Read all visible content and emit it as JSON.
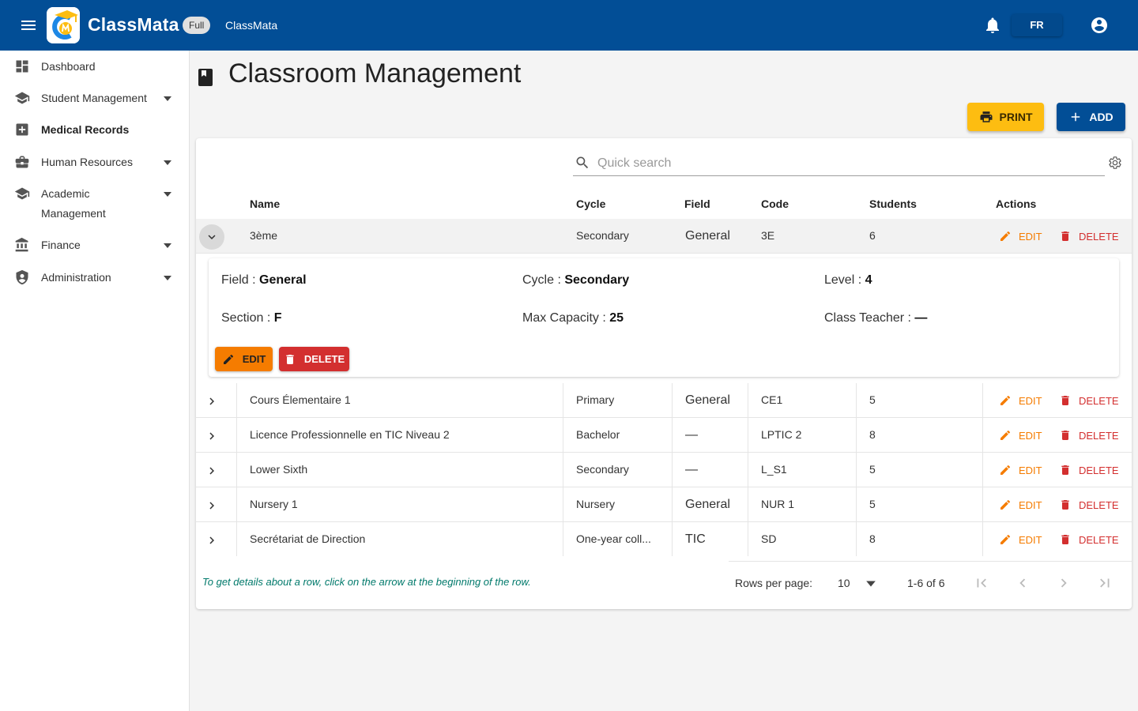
{
  "app": {
    "brand": "ClassMata",
    "plan_badge": "Full",
    "top_link": "ClassMata",
    "language": "FR"
  },
  "sidebar": {
    "items": [
      {
        "label": "Dashboard",
        "icon": "dashboard-icon",
        "has_caret": false,
        "bold": false
      },
      {
        "label": "Student Management",
        "icon": "school-icon",
        "has_caret": true,
        "bold": false
      },
      {
        "label": "Medical Records",
        "icon": "medical-icon",
        "has_caret": false,
        "bold": true
      },
      {
        "label": "Human Resources",
        "icon": "briefcase-icon",
        "has_caret": true,
        "bold": false
      },
      {
        "label": "Academic Management",
        "icon": "school-icon",
        "has_caret": true,
        "bold": false
      },
      {
        "label": "Finance",
        "icon": "bank-icon",
        "has_caret": true,
        "bold": false
      },
      {
        "label": "Administration",
        "icon": "admin-shield-icon",
        "has_caret": true,
        "bold": false
      }
    ]
  },
  "page": {
    "title": "Classroom Management",
    "print_label": "PRINT",
    "add_label": "ADD"
  },
  "search": {
    "placeholder": "Quick search",
    "value": ""
  },
  "table": {
    "columns": [
      "Name",
      "Cycle",
      "Field",
      "Code",
      "Students",
      "Actions"
    ],
    "edit_label": "EDIT",
    "delete_label": "DELETE",
    "rows": [
      {
        "name": "3ème",
        "cycle": "Secondary",
        "field": "General",
        "code": "3E",
        "students": "6",
        "expanded": true
      },
      {
        "name": "Cours Élementaire 1",
        "cycle": "Primary",
        "field": "General",
        "code": "CE1",
        "students": "5",
        "expanded": false
      },
      {
        "name": "Licence Professionnelle en TIC Niveau 2",
        "cycle": "Bachelor",
        "field": "—",
        "code": "LPTIC 2",
        "students": "8",
        "expanded": false
      },
      {
        "name": "Lower Sixth",
        "cycle": "Secondary",
        "field": "—",
        "code": "L_S1",
        "students": "5",
        "expanded": false
      },
      {
        "name": "Nursery 1",
        "cycle": "Nursery",
        "field": "General",
        "code": "NUR 1",
        "students": "5",
        "expanded": false
      },
      {
        "name": "Secrétariat de Direction",
        "cycle": "One-year coll...",
        "field": "TIC",
        "code": "SD",
        "students": "8",
        "expanded": false
      }
    ]
  },
  "detail": {
    "field_label": "Field : ",
    "field_value": "General",
    "cycle_label": "Cycle : ",
    "cycle_value": "Secondary",
    "level_label": "Level : ",
    "level_value": "4",
    "section_label": "Section : ",
    "section_value": "F",
    "capacity_label": "Max Capacity : ",
    "capacity_value": "25",
    "teacher_label": "Class Teacher : ",
    "teacher_value": "—",
    "edit_label": "EDIT",
    "delete_label": "DELETE"
  },
  "footer": {
    "hint": "To get details about a row, click on the arrow at the beginning of the row.",
    "rows_per_page_label": "Rows per page:",
    "rows_per_page_value": "10",
    "range": "1-6 of 6"
  },
  "colors": {
    "primary": "#024e96",
    "print": "#fdbd11",
    "edit": "#f57c00",
    "delete": "#d32f2f",
    "hint": "#00796b"
  }
}
